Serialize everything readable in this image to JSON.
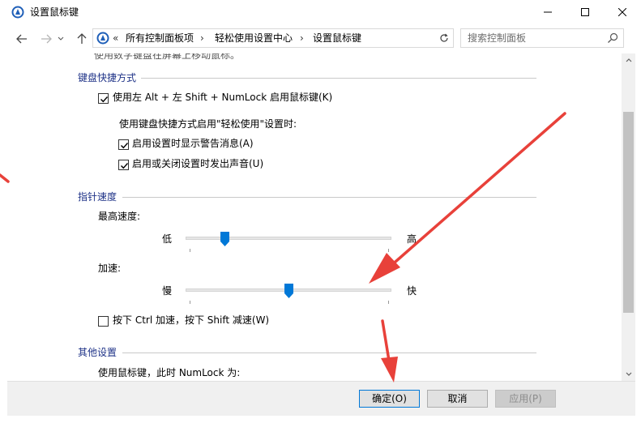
{
  "window": {
    "title": "设置鼠标键",
    "icon": "mouse-keys-icon"
  },
  "address": {
    "overflow": "«",
    "crumbs": [
      "所有控制面板项",
      "轻松使用设置中心",
      "设置鼠标键"
    ],
    "separator": "›"
  },
  "search": {
    "placeholder": "搜索控制面板"
  },
  "content": {
    "partial_top_text": "使用数字键盘在屏幕上移动鼠标。",
    "keyboard_shortcut": {
      "title": "键盘快捷方式",
      "enable_option": {
        "label": "使用左 Alt + 左 Shift + NumLock 启用鼠标键(K)",
        "checked": true
      },
      "sub_heading": "使用键盘快捷方式启用\"轻松使用\"设置时:",
      "warning_option": {
        "label": "启用设置时显示警告消息(A)",
        "checked": true
      },
      "sound_option": {
        "label": "启用或关闭设置时发出声音(U)",
        "checked": true
      }
    },
    "pointer_speed": {
      "title": "指针速度",
      "top_speed": {
        "label": "最高速度:",
        "low": "低",
        "high": "高",
        "value": 0.19
      },
      "acceleration": {
        "label": "加速:",
        "low": "慢",
        "high": "快",
        "value": 0.5
      },
      "ctrl_shift_option": {
        "label": "按下 Ctrl 加速，按下 Shift 减速(W)",
        "checked": false
      }
    },
    "other_settings": {
      "title": "其他设置",
      "numlock_label": "使用鼠标键，此时 NumLock 为:"
    }
  },
  "buttons": {
    "ok": "确定(O)",
    "cancel": "取消",
    "apply": "应用(P)"
  },
  "colors": {
    "section_title": "#1e3287",
    "slider_thumb": "#0078d7",
    "annotation_arrow": "#e8413a"
  }
}
